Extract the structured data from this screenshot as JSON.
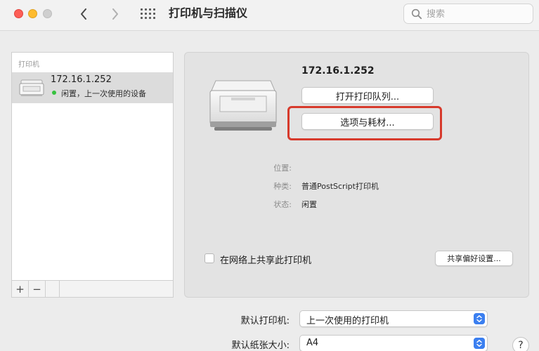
{
  "window": {
    "title": "打印机与扫描仪"
  },
  "search": {
    "placeholder": "搜索"
  },
  "sidebar": {
    "header": "打印机",
    "items": [
      {
        "name": "172.16.1.252",
        "status": "闲置，上一次使用的设备"
      }
    ],
    "add_label": "+",
    "remove_label": "−"
  },
  "detail": {
    "printer_name": "172.16.1.252",
    "open_queue_label": "打开打印队列...",
    "options_label": "选项与耗材...",
    "location_label": "位置:",
    "location_value": "",
    "kind_label": "种类:",
    "kind_value": "普通PostScript打印机",
    "status_label": "状态:",
    "status_value": "闲置",
    "share_label": "在网络上共享此打印机",
    "share_prefs_label": "共享偏好设置..."
  },
  "defaults": {
    "printer_label": "默认打印机:",
    "printer_value": "上一次使用的打印机",
    "paper_label": "默认纸张大小:",
    "paper_value": "A4"
  },
  "help_label": "?",
  "colors": {
    "highlight": "#d73a2c",
    "status_dot": "#37c23f",
    "select_accent": "#3b7ff0"
  }
}
